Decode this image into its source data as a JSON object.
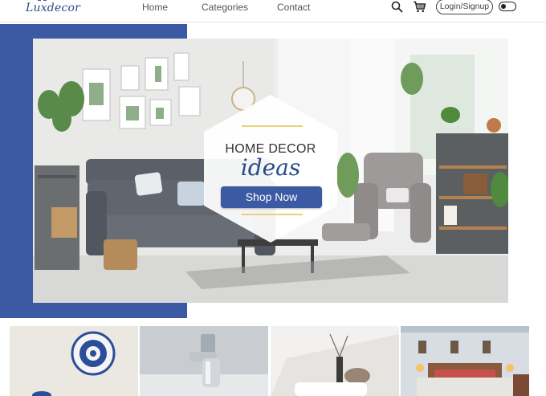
{
  "brand": {
    "name": "Luxdecor"
  },
  "nav": {
    "home": "Home",
    "categories": "Categories",
    "contact": "Contact"
  },
  "header": {
    "search_icon": "search-icon",
    "cart_icon": "cart-icon",
    "login_label": "Login/Signup",
    "theme_toggle": "dark-mode-toggle"
  },
  "hero": {
    "title": "HOME DECOR",
    "subtitle": "ideas",
    "cta_label": "Shop Now",
    "image": "living-room-photo"
  },
  "tiles": [
    {
      "image": "decorative-plates-photo"
    },
    {
      "image": "bathroom-faucet-photo"
    },
    {
      "image": "vase-and-sofa-photo"
    },
    {
      "image": "bedroom-photo"
    }
  ],
  "colors": {
    "accent": "#3c5aa4",
    "brand_text": "#2a4a8c",
    "highlight_line": "#e7d27a"
  }
}
